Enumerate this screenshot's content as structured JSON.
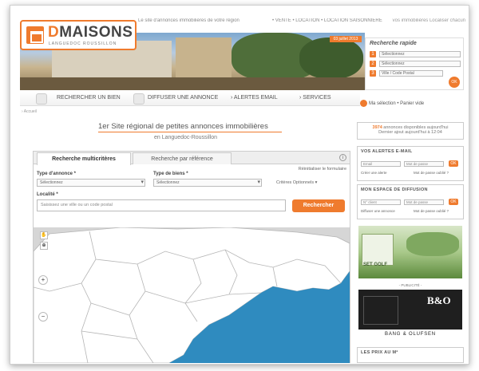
{
  "header": {
    "tagline": "Le site d'annonces immobilières de votre région",
    "links": "• VENTE • LOCATION • LOCATION SAISONNIÈRE",
    "right_link": "vos immobilières Localiser chacun",
    "brand_d": "D",
    "brand_rest": "MAISONS",
    "brand_sub": "LANGUEDOC ROUSSILLON",
    "hero_sign": "03 juillet 2013"
  },
  "quick_search": {
    "title": "Recherche rapide",
    "fields": [
      "Sélectionnez",
      "Sélectionnez",
      "Ville / Code Postal"
    ],
    "numbers": [
      "1",
      "2",
      "3"
    ],
    "go": "OK"
  },
  "nav": {
    "items": [
      "RECHERCHER UN BIEN",
      "DIFFUSER UNE ANNONCE",
      "› ALERTES EMAIL",
      "› SERVICES"
    ],
    "selection": "Ma sélection  •  Panier vide"
  },
  "breadcrumb": "› Accueil",
  "main": {
    "title": "1er Site régional de petites annonces immobilières",
    "subtitle": "en Languedoc-Roussillon"
  },
  "search_panel": {
    "tabs": [
      "Recherche multicritères",
      "Recherche par référence"
    ],
    "info": "i",
    "reset": "Réinitialiser le formulaire",
    "type_annonce_label": "Type d'annonce *",
    "type_annonce_value": "Sélectionnez",
    "type_bien_label": "Type de biens *",
    "type_bien_value": "Sélectionnez",
    "criteria": "Critères Optionnels ▾",
    "localite_label": "Localité *",
    "localite_placeholder": "Saisissez une ville ou un code postal",
    "search_button": "Rechercher"
  },
  "map": {
    "zoom_in": "+",
    "zoom_out": "−",
    "tool1": "✋",
    "tool2": "⊕"
  },
  "sidebar": {
    "count_num": "3974",
    "count_text": "annonces disponibles aujourd'hui",
    "count_sub": "Dernier ajout aujourd'hui à 12:04",
    "alerts_title": "VOS ALERTES E-MAIL",
    "alerts_f1": "Email",
    "alerts_f2": "Mot de passe",
    "alerts_ok": "OK",
    "alerts_link1": "Créer une alerte",
    "alerts_link2": "Mot de passe oublié ?",
    "diff_title": "MON ESPACE DE DIFFUSION",
    "diff_f1": "N° client",
    "diff_f2": "Mot de passe",
    "diff_ok": "OK",
    "diff_link1": "Diffuser une annonce",
    "diff_link2": "Mot de passe oublié ?",
    "ad1_text": "SET GOLF",
    "pub_label": "- PUBLICITÉ -",
    "ad2_text": "BANG & OLUFSEN",
    "ad2_logo": "B&O",
    "prix_title": "LES PRIX AU M²"
  },
  "colors": {
    "accent": "#ef7b2e",
    "sea": "#2f8bbf",
    "land": "#ffffff",
    "outside": "#d6d6d6"
  }
}
